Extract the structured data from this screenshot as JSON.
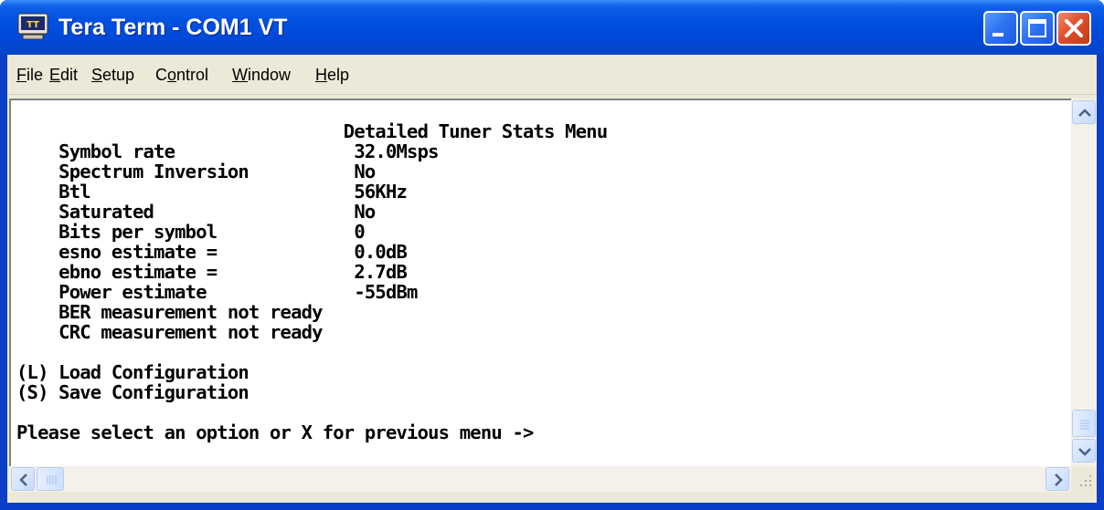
{
  "window": {
    "title": "Tera Term - COM1 VT",
    "icon": "teraterm-app-icon",
    "colors": {
      "titlebar": "#0050e0",
      "close": "#e0502c",
      "menubar": "#ece9d8"
    }
  },
  "menu": {
    "items": [
      {
        "accel": "F",
        "rest": "ile"
      },
      {
        "accel": "E",
        "rest": "dit"
      },
      {
        "accel": "S",
        "rest": "etup"
      },
      {
        "pre": "C",
        "accel": "o",
        "rest": "ntrol"
      },
      {
        "accel": "W",
        "rest": "indow"
      },
      {
        "accel": "H",
        "rest": "elp"
      }
    ]
  },
  "terminal": {
    "lines": [
      "                               Detailed Tuner Stats Menu",
      "    Symbol rate                 32.0Msps",
      "    Spectrum Inversion          No",
      "    Btl                         56KHz",
      "    Saturated                   No",
      "    Bits per symbol             0",
      "    esno estimate =             0.0dB",
      "    ebno estimate =             2.7dB",
      "    Power estimate              -55dBm",
      "    BER measurement not ready",
      "    CRC measurement not ready",
      "",
      "(L) Load Configuration",
      "(S) Save Configuration",
      "",
      "Please select an option or X for previous menu ->"
    ]
  },
  "scrollbars": {
    "vertical_position": 1.0,
    "horizontal_position": 0.0
  }
}
